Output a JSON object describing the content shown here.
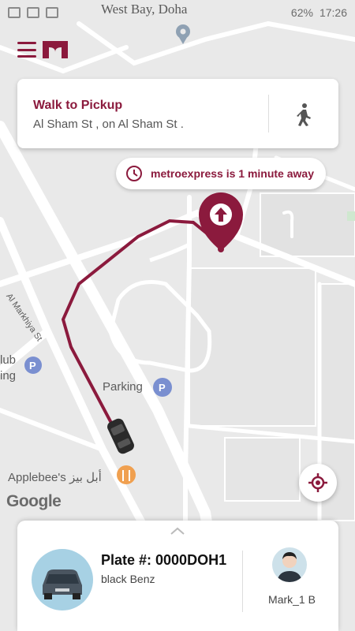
{
  "status_bar": {
    "location": "West Bay, Doha",
    "battery": "62%",
    "time": "17:26"
  },
  "pickup": {
    "title": "Walk to Pickup",
    "address": "Al Sham St , on Al Sham St ."
  },
  "eta": {
    "text": "metroexpress is 1 minute away"
  },
  "map": {
    "labels": {
      "parking": "Parking",
      "applebees": "Applebee's أبل بيز",
      "club": "lub\ning",
      "road_markhiya": "Al Markhiya St"
    },
    "google": "Google"
  },
  "driver": {
    "plate": "Plate #: 0000DOH1",
    "car": "black Benz",
    "name": "Mark_1 B"
  },
  "colors": {
    "brand": "#8b1a3d",
    "map_bg": "#e9e9e9",
    "road": "#ffffff"
  },
  "icons": [
    "menu-icon",
    "brand-logo",
    "walk-icon",
    "clock-icon",
    "pickup-pin-icon",
    "locate-icon",
    "car-icon",
    "driver-avatar-icon"
  ]
}
